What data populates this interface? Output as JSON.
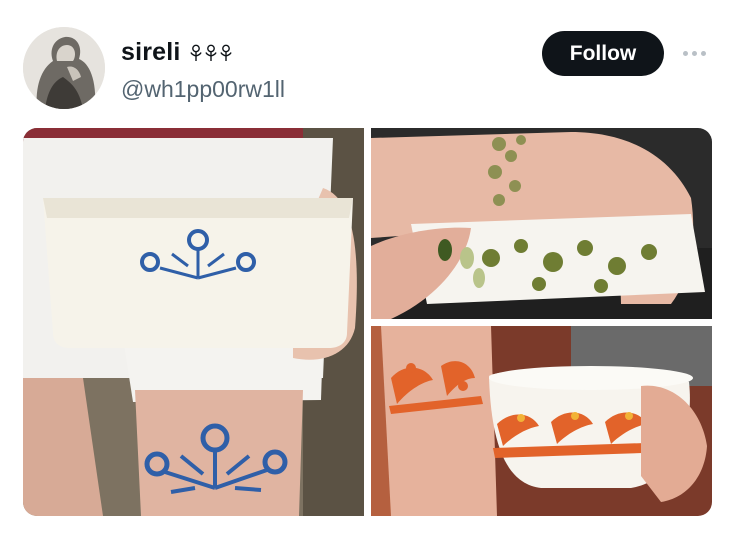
{
  "post": {
    "author": {
      "display_name": "sireli",
      "handle": "@wh1pp00rw1ll",
      "name_emoji": [
        "flower-emoji",
        "flower-emoji",
        "flower-emoji"
      ],
      "avatar": "avatar-photo"
    },
    "follow_label": "Follow",
    "more_icon": "more-dots-icon",
    "media": [
      {
        "id": "thigh-tattoo-cornflower-dish",
        "icon": "photo"
      },
      {
        "id": "wrist-tattoo-green-floral-dish",
        "icon": "photo"
      },
      {
        "id": "arm-tattoo-orange-bird-bowl",
        "icon": "photo"
      }
    ]
  },
  "colors": {
    "follow_bg": "#0f1419",
    "handle": "#536471",
    "cornflower_blue": "#2f5fa8",
    "spring_green": "#6f7d33",
    "friendship_orange": "#e2632a"
  }
}
